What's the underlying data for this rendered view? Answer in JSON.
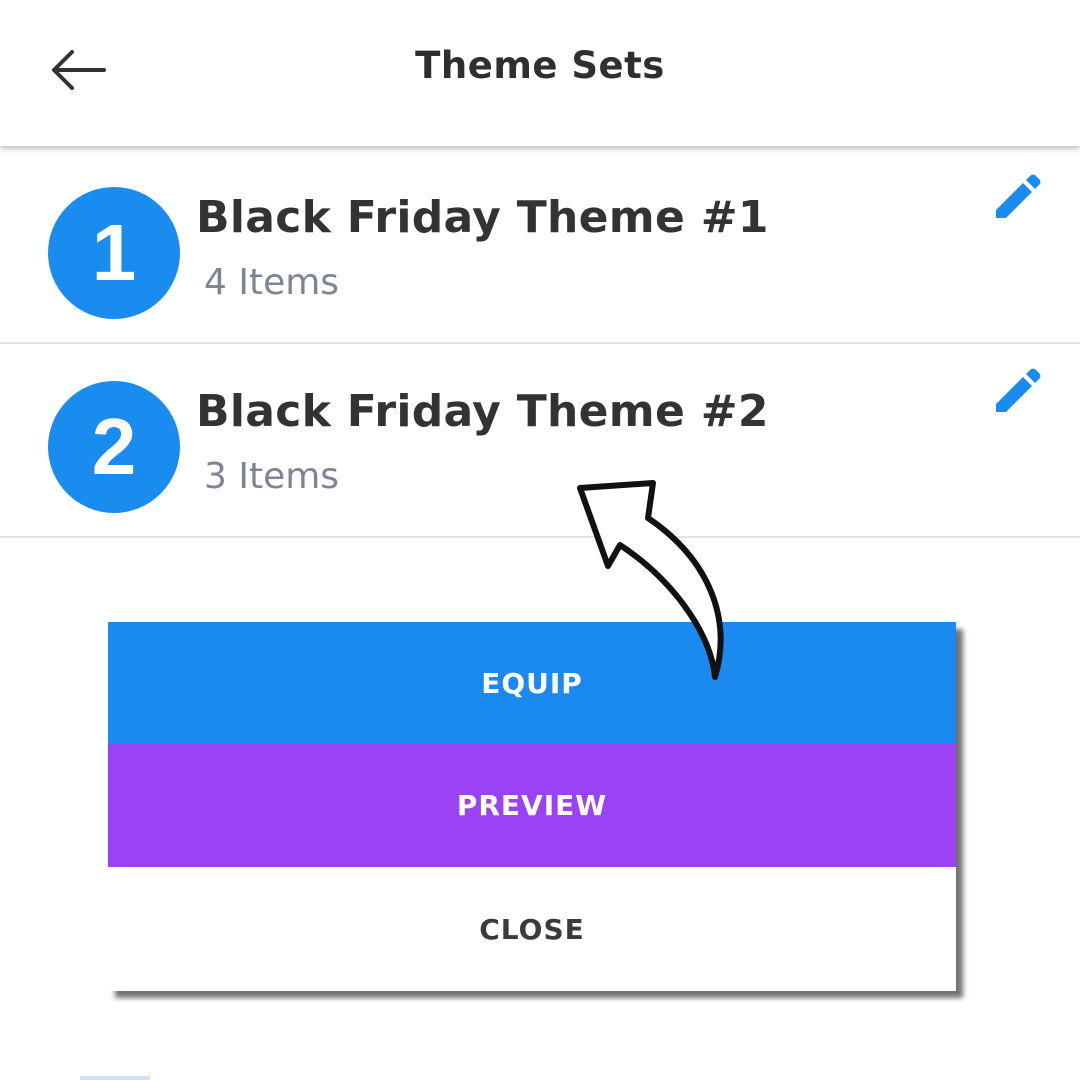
{
  "header": {
    "title": "Theme Sets",
    "back_icon": "arrow-left-icon"
  },
  "theme_sets": [
    {
      "number": "1",
      "name": "Black Friday Theme #1",
      "items": "4 Items",
      "edit_icon": "pencil-edit-icon"
    },
    {
      "number": "2",
      "name": "Black Friday Theme #2",
      "items": "3 Items",
      "edit_icon": "pencil-edit-icon"
    }
  ],
  "popup": {
    "equip_label": "EQUIP",
    "preview_label": "PREVIEW",
    "close_label": "CLOSE"
  },
  "annotation": {
    "icon": "curved-arrow-pointer-icon"
  },
  "colors": {
    "accent_blue": "#1a8cf0",
    "equip_blue": "#1a8af0",
    "preview_purple": "#9b42f5",
    "title_text": "#333333",
    "subtitle_text": "#7d8494"
  }
}
